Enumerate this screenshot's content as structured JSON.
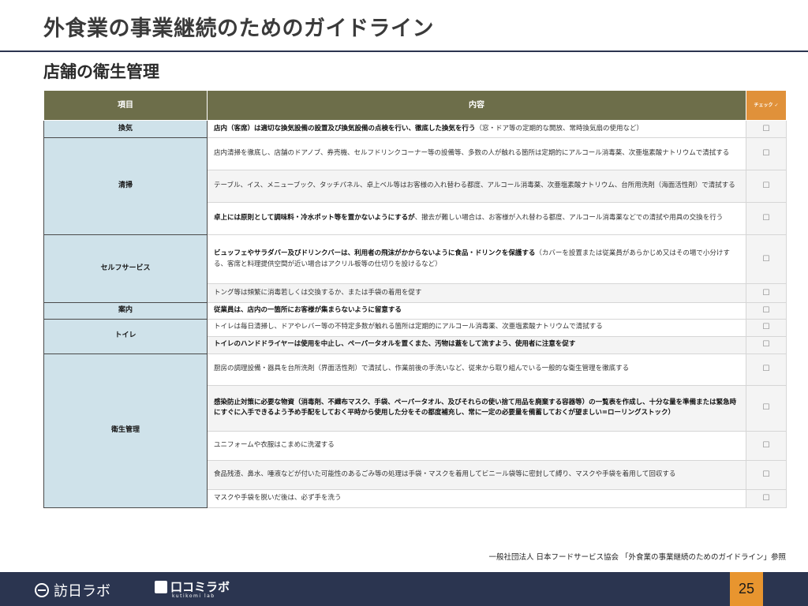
{
  "slide_title": "外食業の事業継続のためのガイドライン",
  "section_title": "店舗の衛生管理",
  "table": {
    "headers": {
      "item": "項目",
      "content": "内容",
      "check": "チェック ✓"
    },
    "check_box": "☐",
    "rows": [
      {
        "category": "換気",
        "items": [
          {
            "bold": "店内（客席）は適切な換気設備の設置及び換気設備の点検を行い、徹底した換気を行う",
            "text": "（窓・ドア等の定期的な開放、常時換気扇の使用など）"
          }
        ]
      },
      {
        "category": "清掃",
        "items": [
          {
            "bold": "",
            "text": "店内清掃を徹底し、店舗のドアノブ、券売機、セルフドリンクコーナー等の設備等、多数の人が触れる箇所は定期的にアルコール消毒薬、次亜塩素酸ナトリウムで清拭する"
          },
          {
            "bold": "",
            "text": "テーブル、イス、メニューブック、タッチパネル、卓上ベル等はお客様の入れ替わる都度、アルコール消毒薬、次亜塩素酸ナトリウム、台所用洗剤（海面活性剤）で清拭する"
          },
          {
            "bold": "卓上には原則として調味料・冷水ポット等を置かないようにするが",
            "text": "、撤去が難しい場合は、お客様が入れ替わる都度、アルコール消毒薬などでの清拭や用具の交換を行う"
          }
        ]
      },
      {
        "category": "セルフサービス",
        "items": [
          {
            "bold": "ビュッフェやサラダバー及びドリンクバーは、利用者の飛沫がかからないように食品・ドリンクを保護する",
            "text": "（カバーを設置または従業員があらかじめ又はその場で小分けする、客席と料理提供空間が近い場合はアクリル板等の仕切りを設けるなど）"
          },
          {
            "bold": "",
            "text": "トング等は頻繁に消毒若しくは交換するか、または手袋の着用を促す"
          }
        ]
      },
      {
        "category": "案内",
        "items": [
          {
            "bold": "従業員は、店内の一箇所にお客様が集まらないように留意する",
            "text": ""
          }
        ]
      },
      {
        "category": "トイレ",
        "items": [
          {
            "bold": "",
            "text": "トイレは毎日清掃し、ドアやレバー等の不特定多数が触れる箇所は定期的にアルコール消毒薬、次亜塩素酸ナトリウムで清拭する"
          },
          {
            "bold": "トイレのハンドドライヤーは使用を中止し、ペーパータオルを置くまた、汚物は蓋をして流すよう、使用者に注意を促す",
            "text": ""
          }
        ]
      },
      {
        "category": "衛生管理",
        "items": [
          {
            "bold": "",
            "text": "厨房の調理設備・器具を台所洗剤（界面活性剤）で清拭し、作業前後の手洗いなど、従来から取り組んでいる一般的な衛生管理を徹底する"
          },
          {
            "bold": "感染防止対策に必要な物資（消毒剤、不織布マスク、手袋、ペーパータオル、及びそれらの使い捨て用品を廃棄する容器等）の一覧表を作成し、十分な量を準備または緊急時にすぐに入手できるよう予め手配をしておく平時から使用した分をその都度補充し、常に一定の必要量を備蓄しておくが望ましい=ローリングストック）",
            "text": ""
          },
          {
            "bold": "",
            "text": "ユニフォームや衣服はこまめに洗濯する"
          },
          {
            "bold": "",
            "text": "食品残渣、鼻水、唾液などが付いた可能性のあるごみ等の処理は手袋・マスクを着用してビニール袋等に密封して縛り、マスクや手袋を着用して回収する"
          },
          {
            "bold": "",
            "text": "マスクや手袋を脱いだ後は、必ず手を洗う"
          }
        ]
      }
    ]
  },
  "source_note": "一般社団法人 日本フードサービス協会 「外食業の事業継続のためのガイドライン」参照",
  "footer": {
    "logo1_text": "訪日ラボ",
    "logo2_text": "口コミラボ",
    "logo2_sub": "kutikomi lab",
    "page_number": "25"
  }
}
